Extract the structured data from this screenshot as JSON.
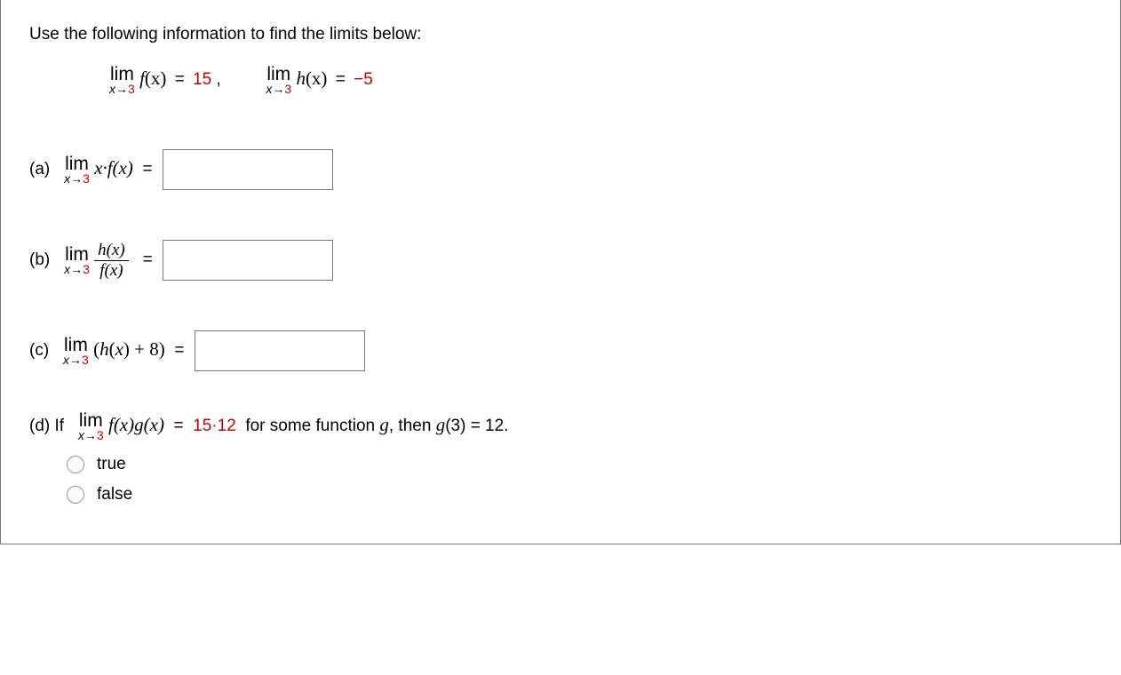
{
  "prompt": "Use the following information to find the limits below:",
  "given": {
    "f": {
      "limtext": "lim",
      "under_l": "x",
      "under_arrow": "→",
      "under_r": "3",
      "fn": "f",
      "var": "(x)",
      "eq": "=",
      "val": "15",
      "comma": ","
    },
    "h": {
      "limtext": "lim",
      "under_l": "x",
      "under_arrow": "→",
      "under_r": "3",
      "fn": "h",
      "var": "(x)",
      "eq": "=",
      "val": "−5"
    }
  },
  "parts": {
    "a": {
      "label": "(a)",
      "lim": "lim",
      "under_l": "x",
      "under_arrow": "→",
      "under_r": "3",
      "body": "x·f(x)",
      "eq": "="
    },
    "b": {
      "label": "(b)",
      "lim": "lim",
      "under_l": "x",
      "under_arrow": "→",
      "under_r": "3",
      "top": "h(x)",
      "bot": "f(x)",
      "eq": "="
    },
    "c": {
      "label": "(c)",
      "lim": "lim",
      "under_l": "x",
      "under_arrow": "→",
      "under_r": "3",
      "body": "(h(x) + 8)",
      "eq": "="
    },
    "d": {
      "label": "(d) If",
      "lim": "lim",
      "under_l": "x",
      "under_arrow": "→",
      "under_r": "3",
      "body": "f(x)g(x)",
      "eq": "=",
      "rhs_pre": "15·12",
      "rhs_mid": " for some function ",
      "rhs_g": "g",
      "rhs_mid2": ", then ",
      "rhs_g3": "g",
      "rhs_g3arg": "(3) = 12."
    }
  },
  "options": {
    "true": "true",
    "false": "false"
  }
}
